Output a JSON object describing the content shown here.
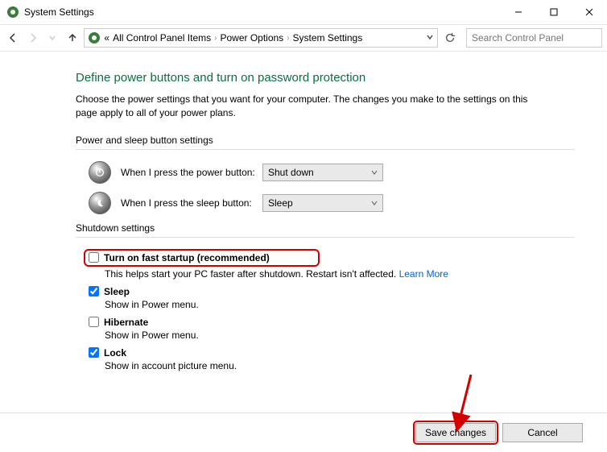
{
  "window": {
    "title": "System Settings"
  },
  "breadcrumb": {
    "icon_sep": "«",
    "item1": "All Control Panel Items",
    "item2": "Power Options",
    "item3": "System Settings"
  },
  "search": {
    "placeholder": "Search Control Panel"
  },
  "page": {
    "heading": "Define power buttons and turn on password protection",
    "desc": "Choose the power settings that you want for your computer. The changes you make to the settings on this page apply to all of your power plans."
  },
  "section1": {
    "title": "Power and sleep button settings",
    "power_label": "When I press the power button:",
    "power_value": "Shut down",
    "sleep_label": "When I press the sleep button:",
    "sleep_value": "Sleep"
  },
  "section2": {
    "title": "Shutdown settings",
    "fast": {
      "label": "Turn on fast startup (recommended)",
      "sub": "This helps start your PC faster after shutdown. Restart isn't affected.",
      "learn": "Learn More"
    },
    "sleep": {
      "label": "Sleep",
      "sub": "Show in Power menu."
    },
    "hibernate": {
      "label": "Hibernate",
      "sub": "Show in Power menu."
    },
    "lock": {
      "label": "Lock",
      "sub": "Show in account picture menu."
    }
  },
  "footer": {
    "save": "Save changes",
    "cancel": "Cancel"
  }
}
